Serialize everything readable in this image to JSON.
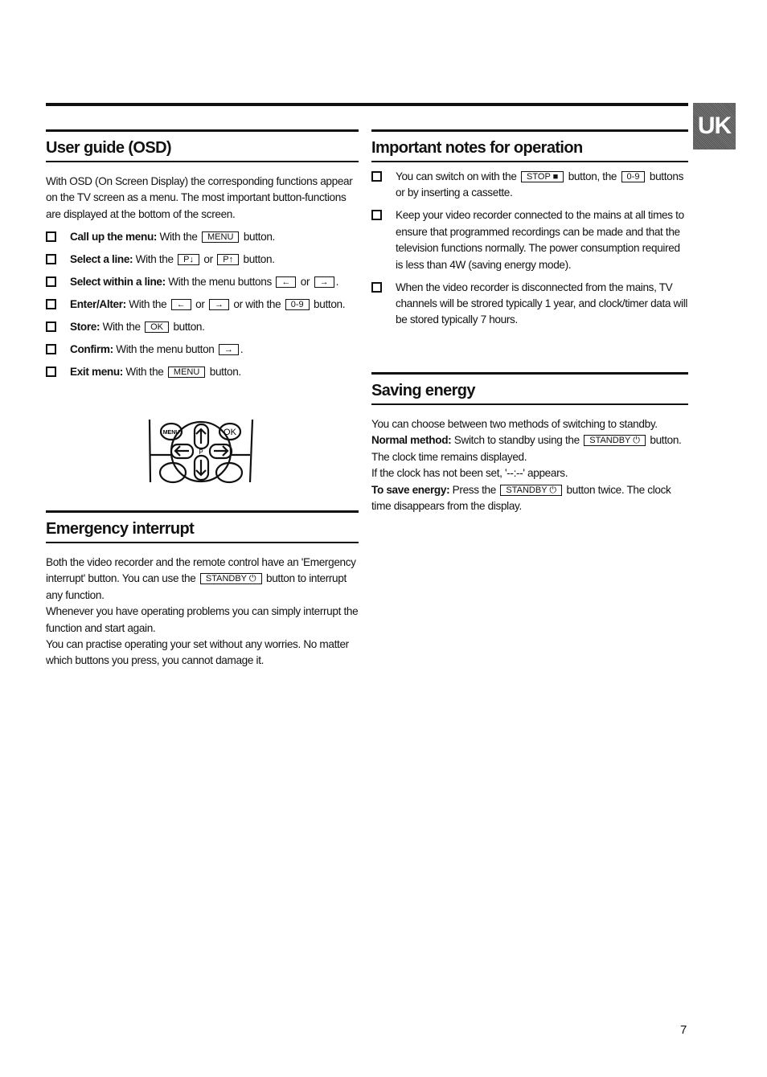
{
  "side_tab": "UK",
  "page_number": "7",
  "user_guide": {
    "title": "User guide (OSD)",
    "intro": "With OSD (On Screen Display) the corresponding functions appear on the TV screen as a menu. The most important button-functions are displayed at the bottom of the screen.",
    "items": [
      {
        "label": "Call up the menu:",
        "parts": [
          {
            "t": " With the "
          },
          {
            "b": "MENU"
          },
          {
            "t": " button."
          }
        ]
      },
      {
        "label": "Select a line:",
        "parts": [
          {
            "t": " With the "
          },
          {
            "b": "P↓"
          },
          {
            "t": " or "
          },
          {
            "b": "P↑"
          },
          {
            "t": " button."
          }
        ]
      },
      {
        "label": "Select within a line:",
        "parts": [
          {
            "t": " With the menu buttons "
          },
          {
            "b": "←"
          },
          {
            "t": " or "
          },
          {
            "b": "→"
          },
          {
            "t": "."
          }
        ]
      },
      {
        "label": "Enter/Alter:",
        "parts": [
          {
            "t": " With the "
          },
          {
            "b": "←"
          },
          {
            "t": " or "
          },
          {
            "b": "→"
          },
          {
            "t": " or with the "
          },
          {
            "b": "0-9"
          },
          {
            "t": " button."
          }
        ]
      },
      {
        "label": "Store:",
        "parts": [
          {
            "t": " With the "
          },
          {
            "b": "OK"
          },
          {
            "t": " button."
          }
        ]
      },
      {
        "label": "Confirm:",
        "parts": [
          {
            "t": " With the menu button "
          },
          {
            "b": "→"
          },
          {
            "t": "."
          }
        ]
      },
      {
        "label": "Exit menu:",
        "parts": [
          {
            "t": " With the "
          },
          {
            "b": "MENU"
          },
          {
            "t": " button."
          }
        ]
      }
    ],
    "remote": {
      "menu": "MENU",
      "ok": "OK",
      "p": "P"
    }
  },
  "emergency": {
    "title": "Emergency interrupt",
    "paragraphs": [
      [
        {
          "t": "Both the video recorder and the remote control have an 'Emergency interrupt' button. You can use the "
        },
        {
          "b": "STANDBY ⏻"
        },
        {
          "t": " button to interrupt any function."
        }
      ],
      [
        {
          "t": "Whenever you have operating problems you can simply interrupt the function and start again."
        }
      ],
      [
        {
          "t": "You can practise operating your set without any worries. No matter which buttons you press, you cannot damage it."
        }
      ]
    ]
  },
  "notes": {
    "title": "Important notes for operation",
    "items": [
      {
        "label": "",
        "parts": [
          {
            "t": "You can switch on with the "
          },
          {
            "b": "STOP ■"
          },
          {
            "t": " button, the "
          },
          {
            "b": "0-9"
          },
          {
            "t": " buttons or by inserting a cassette."
          }
        ]
      },
      {
        "label": "",
        "parts": [
          {
            "t": "Keep your video recorder connected to the mains at all times to ensure that programmed recordings can be made and that the television functions normally. The power consumption required is less than 4W (saving energy mode)."
          }
        ]
      },
      {
        "label": "",
        "parts": [
          {
            "t": "When the video recorder is disconnected from the mains, TV channels will be strored typically 1 year, and clock/timer data will be stored typically 7 hours."
          }
        ]
      }
    ]
  },
  "saving": {
    "title": "Saving energy",
    "paragraphs": [
      [
        {
          "t": "You can choose between two methods of switching to standby."
        }
      ],
      [
        {
          "s": "Normal method:"
        },
        {
          "t": " Switch to standby using the "
        },
        {
          "b": "STANDBY ⏻"
        },
        {
          "t": " button. The clock time remains displayed."
        }
      ],
      [
        {
          "t": "If the clock has not been set, '--:--' appears."
        }
      ],
      [
        {
          "s": "To save energy:"
        },
        {
          "t": " Press the "
        },
        {
          "b": "STANDBY ⏻"
        },
        {
          "t": " button twice. The clock time disappears from the display."
        }
      ]
    ]
  }
}
